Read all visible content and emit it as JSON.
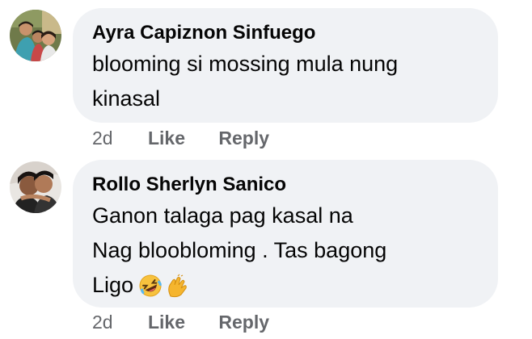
{
  "comments": [
    {
      "author": "Ayra Capiznon Sinfuego",
      "text_lines": [
        "blooming si mossing mula nung",
        "kinasal"
      ],
      "time": "2d",
      "like_label": "Like",
      "reply_label": "Reply"
    },
    {
      "author": "Rollo Sherlyn Sanico",
      "text_lines": [
        "Ganon talaga pag kasal na",
        "Nag bloobloming . Tas bagong",
        "Ligo"
      ],
      "emojis": [
        "rolling-laughing-emoji",
        "pinching-hand-emoji"
      ],
      "time": "2d",
      "like_label": "Like",
      "reply_label": "Reply"
    }
  ],
  "colors": {
    "bubble_bg": "#f0f2f5",
    "text": "#050505",
    "meta": "#65676b"
  }
}
